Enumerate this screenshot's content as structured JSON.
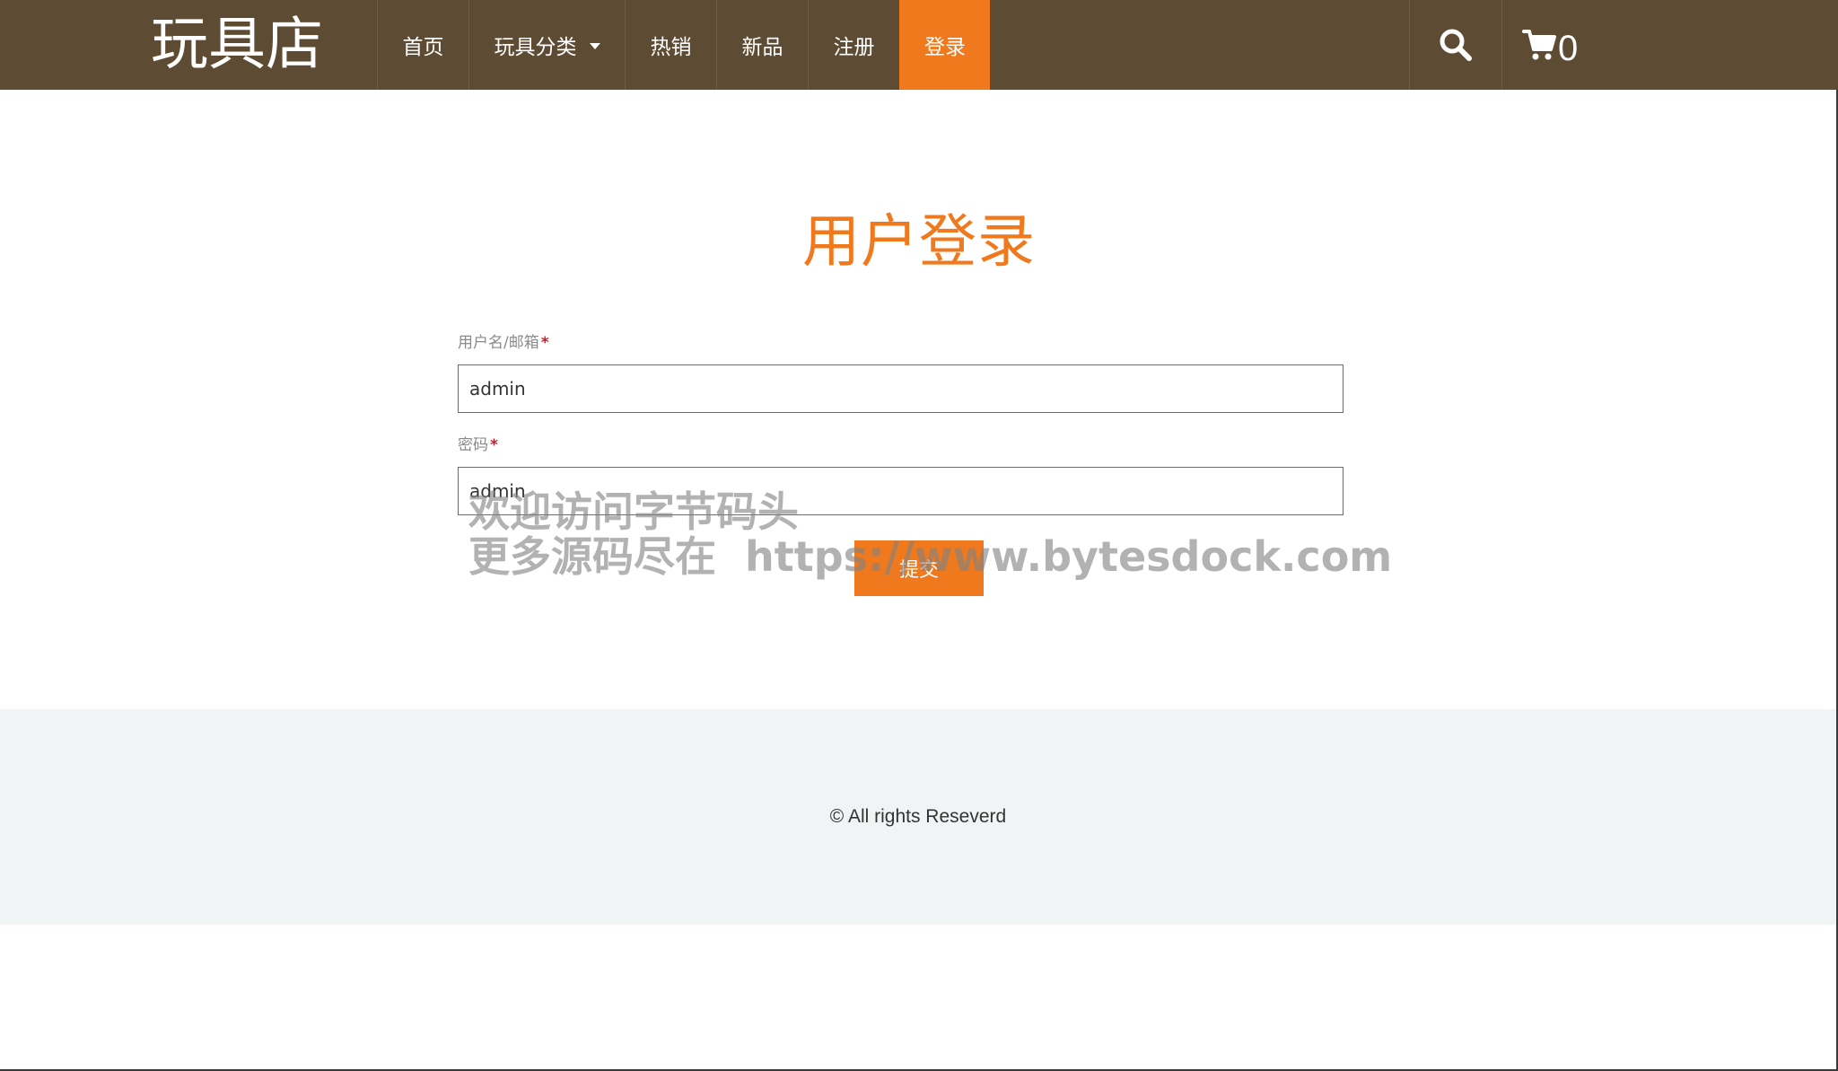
{
  "header": {
    "logo": "玩具店",
    "nav": [
      {
        "label": "首页"
      },
      {
        "label": "玩具分类"
      },
      {
        "label": "热销"
      },
      {
        "label": "新品"
      },
      {
        "label": "注册"
      },
      {
        "label": "登录"
      }
    ],
    "cart_count": "0",
    "search_icon": "search-icon",
    "cart_icon": "cart-icon"
  },
  "main": {
    "title": "用户登录",
    "username": {
      "label": "用户名/邮箱",
      "required_mark": "*",
      "value": "admin"
    },
    "password": {
      "label": "密码",
      "required_mark": "*",
      "value": "admin"
    },
    "submit_label": "提交"
  },
  "watermark": {
    "line1": "欢迎访问字节码头",
    "line2": "更多源码尽在  https://www.bytesdock.com"
  },
  "footer": {
    "copyright": "© All rights Reseverd"
  },
  "colors": {
    "header_bg": "#5e4b33",
    "accent": "#f0791e",
    "required": "#d4162b",
    "footer_bg": "#f1f4f5"
  }
}
